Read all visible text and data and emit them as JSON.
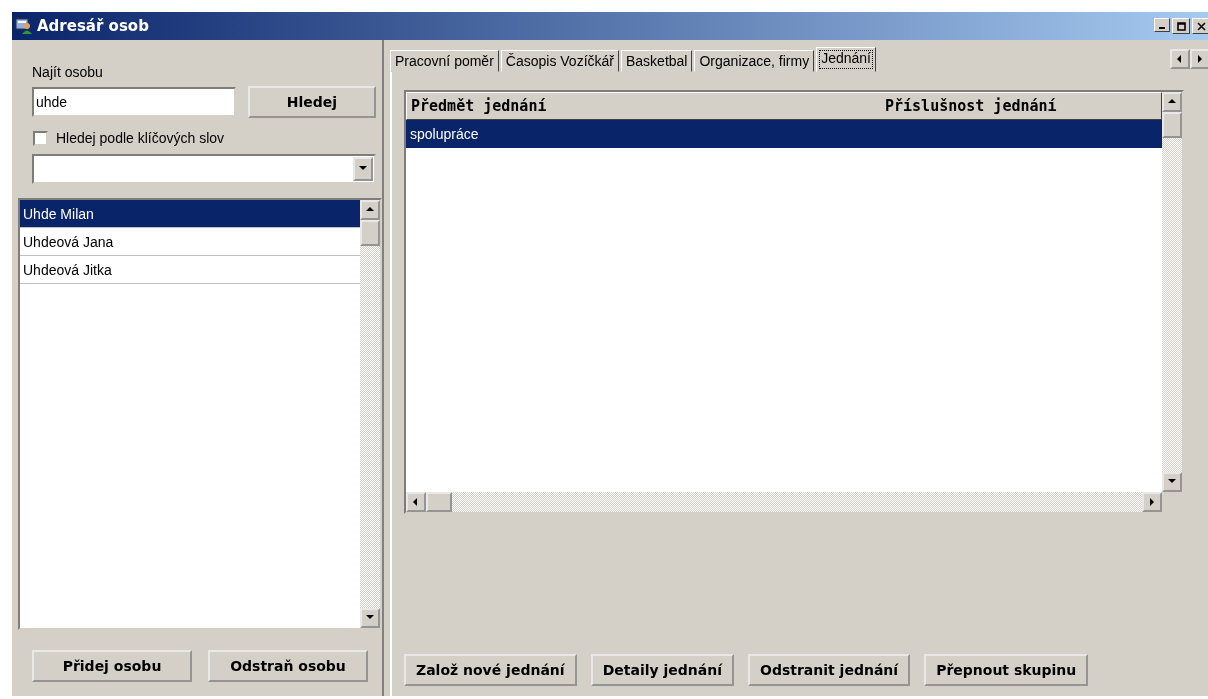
{
  "window": {
    "title": "Adresář osob"
  },
  "search": {
    "label": "Najít osobu",
    "value": "uhde",
    "button": "Hledej",
    "keyword_checkbox": {
      "label": "Hledej podle klíčových slov",
      "checked": false
    }
  },
  "people": [
    {
      "name": "Uhde Milan",
      "selected": true
    },
    {
      "name": "Uhdeová Jana",
      "selected": false
    },
    {
      "name": "Uhdeová Jitka",
      "selected": false
    }
  ],
  "people_buttons": [
    "Přidej osobu",
    "Odstraň osobu"
  ],
  "tabs": [
    {
      "label": "Pracovní poměr",
      "selected": false
    },
    {
      "label": "Časopis Vozíčkář",
      "selected": false
    },
    {
      "label": "Basketbal",
      "selected": false
    },
    {
      "label": "Organizace, firmy",
      "selected": false
    },
    {
      "label": "Jednání",
      "selected": true
    }
  ],
  "table": {
    "columns": [
      "Předmět jednání",
      "Příslušnost jednání"
    ],
    "rows": [
      {
        "cells": [
          "spolupráce",
          ""
        ],
        "selected": true
      }
    ]
  },
  "meeting_buttons": [
    "Založ nové jednání",
    "Detaily jednání",
    "Odstranit jednání",
    "Přepnout skupinu"
  ]
}
